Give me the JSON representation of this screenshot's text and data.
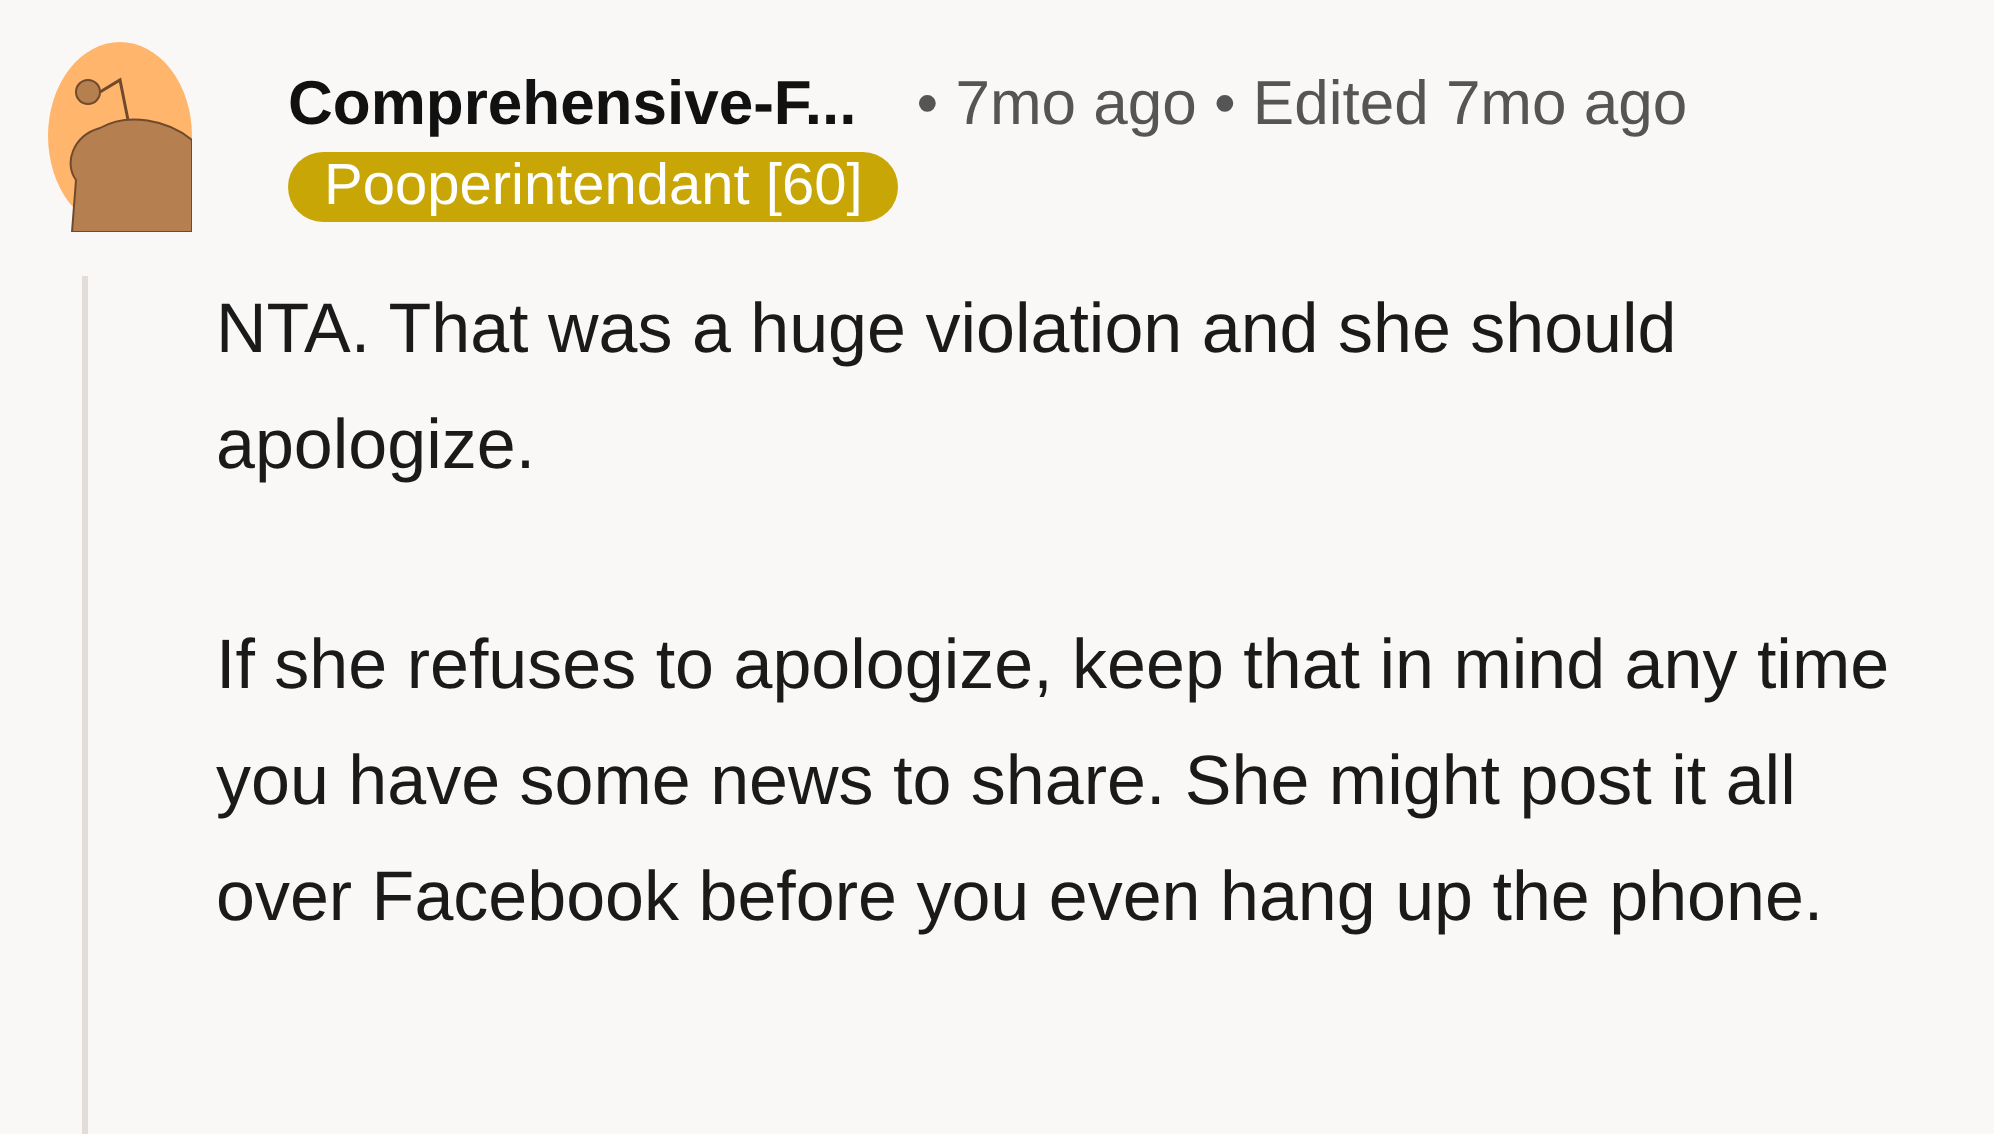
{
  "comment": {
    "author": "Comprehensive-F...",
    "meta": "• 7mo ago • Edited 7mo ago",
    "flair": {
      "text": "Pooperintendant [60]",
      "color": "#c8a606"
    },
    "body": [
      "NTA. That was a huge violation and she should apologize.",
      "If she refuses to apologize, keep that in mind any time you have some news to share. She might post it all over Facebook before you even hang up the phone."
    ]
  }
}
